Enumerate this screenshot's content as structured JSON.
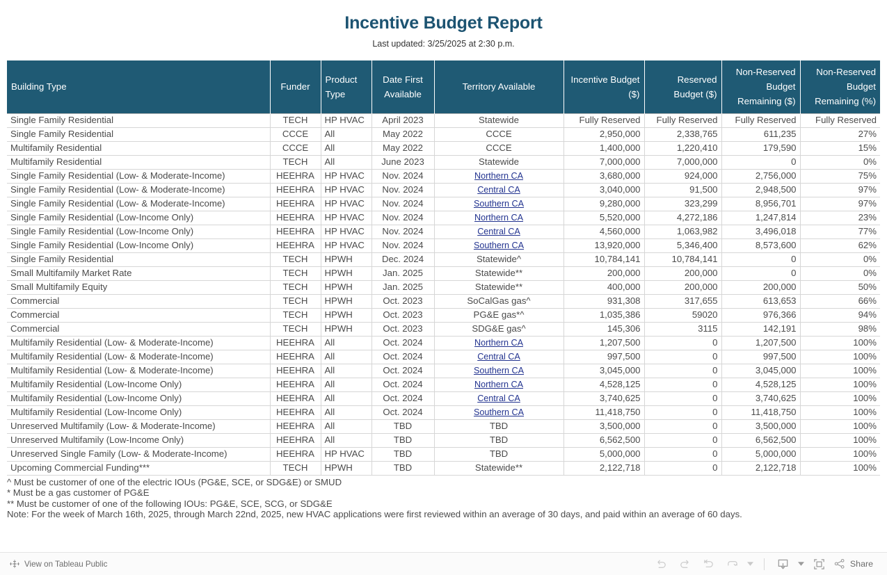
{
  "header": {
    "title": "Incentive Budget Report",
    "subtitle": "Last updated: 3/25/2025 at 2:30 p.m.",
    "title_color": "#1c5371"
  },
  "table": {
    "header_bg": "#1f5a74",
    "link_color": "#22338f",
    "columns": [
      {
        "label": "Building Type",
        "align": "h-left"
      },
      {
        "label": "Funder",
        "align": "h-center"
      },
      {
        "label": "Product Type",
        "align": "h-left"
      },
      {
        "label": "Date First Available",
        "align": "h-center"
      },
      {
        "label": "Territory Available",
        "align": "h-center"
      },
      {
        "label": "Incentive Budget ($)",
        "align": "h-right"
      },
      {
        "label": "Reserved Budget ($)",
        "align": "h-right"
      },
      {
        "label": "Non-Reserved Budget Remaining ($)",
        "align": "h-right"
      },
      {
        "label": "Non-Reserved Budget Remaining (%)",
        "align": "h-right"
      }
    ],
    "rows": [
      {
        "building_type": "Single Family Residential",
        "funder": "TECH",
        "product_type": "HP HVAC",
        "date_first_available": "April 2023",
        "territory": "Statewide",
        "territory_link": false,
        "incentive_budget": "Fully Reserved",
        "reserved_budget": "Fully Reserved",
        "non_reserved_remaining": "Fully Reserved",
        "non_reserved_pct": "Fully Reserved",
        "group_end": false
      },
      {
        "building_type": "Single Family Residential",
        "funder": "CCCE",
        "product_type": "All",
        "date_first_available": "May 2022",
        "territory": "CCCE",
        "territory_link": false,
        "incentive_budget": "2,950,000",
        "reserved_budget": "2,338,765",
        "non_reserved_remaining": "611,235",
        "non_reserved_pct": "27%",
        "group_end": false
      },
      {
        "building_type": "Multifamily Residential",
        "funder": "CCCE",
        "product_type": "All",
        "date_first_available": "May 2022",
        "territory": "CCCE",
        "territory_link": false,
        "incentive_budget": "1,400,000",
        "reserved_budget": "1,220,410",
        "non_reserved_remaining": "179,590",
        "non_reserved_pct": "15%",
        "group_end": false
      },
      {
        "building_type": "Multifamily Residential",
        "funder": "TECH",
        "product_type": "All",
        "date_first_available": "June 2023",
        "territory": "Statewide",
        "territory_link": false,
        "incentive_budget": "7,000,000",
        "reserved_budget": "7,000,000",
        "non_reserved_remaining": "0",
        "non_reserved_pct": "0%",
        "group_end": true
      },
      {
        "building_type": "Single Family Residential (Low- & Moderate-Income)",
        "funder": "HEEHRA",
        "product_type": "HP HVAC",
        "date_first_available": "Nov. 2024",
        "territory": "Northern CA",
        "territory_link": true,
        "incentive_budget": "3,680,000",
        "reserved_budget": "924,000",
        "non_reserved_remaining": "2,756,000",
        "non_reserved_pct": "75%",
        "group_end": false
      },
      {
        "building_type": "Single Family Residential (Low- & Moderate-Income)",
        "funder": "HEEHRA",
        "product_type": "HP HVAC",
        "date_first_available": "Nov. 2024",
        "territory": "Central CA",
        "territory_link": true,
        "incentive_budget": "3,040,000",
        "reserved_budget": "91,500",
        "non_reserved_remaining": "2,948,500",
        "non_reserved_pct": "97%",
        "group_end": false
      },
      {
        "building_type": "Single Family Residential (Low- & Moderate-Income)",
        "funder": "HEEHRA",
        "product_type": "HP HVAC",
        "date_first_available": "Nov. 2024",
        "territory": "Southern CA",
        "territory_link": true,
        "incentive_budget": "9,280,000",
        "reserved_budget": "323,299",
        "non_reserved_remaining": "8,956,701",
        "non_reserved_pct": "97%",
        "group_end": false
      },
      {
        "building_type": "Single Family Residential (Low-Income Only)",
        "funder": "HEEHRA",
        "product_type": "HP HVAC",
        "date_first_available": "Nov. 2024",
        "territory": "Northern CA",
        "territory_link": true,
        "incentive_budget": "5,520,000",
        "reserved_budget": "4,272,186",
        "non_reserved_remaining": "1,247,814",
        "non_reserved_pct": "23%",
        "group_end": false
      },
      {
        "building_type": "Single Family Residential (Low-Income Only)",
        "funder": "HEEHRA",
        "product_type": "HP HVAC",
        "date_first_available": "Nov. 2024",
        "territory": "Central CA",
        "territory_link": true,
        "incentive_budget": "4,560,000",
        "reserved_budget": "1,063,982",
        "non_reserved_remaining": "3,496,018",
        "non_reserved_pct": "77%",
        "group_end": false
      },
      {
        "building_type": "Single Family Residential (Low-Income Only)",
        "funder": "HEEHRA",
        "product_type": "HP HVAC",
        "date_first_available": "Nov. 2024",
        "territory": "Southern CA",
        "territory_link": true,
        "incentive_budget": "13,920,000",
        "reserved_budget": "5,346,400",
        "non_reserved_remaining": "8,573,600",
        "non_reserved_pct": "62%",
        "group_end": true
      },
      {
        "building_type": "Single Family Residential",
        "funder": "TECH",
        "product_type": "HPWH",
        "date_first_available": "Dec. 2024",
        "territory": "Statewide^",
        "territory_link": false,
        "incentive_budget": "10,784,141",
        "reserved_budget": "10,784,141",
        "non_reserved_remaining": "0",
        "non_reserved_pct": "0%",
        "group_end": true
      },
      {
        "building_type": "Small Multifamily Market Rate",
        "funder": "TECH",
        "product_type": "HPWH",
        "date_first_available": "Jan. 2025",
        "territory": "Statewide**",
        "territory_link": false,
        "incentive_budget": "200,000",
        "reserved_budget": "200,000",
        "non_reserved_remaining": "0",
        "non_reserved_pct": "0%",
        "group_end": false
      },
      {
        "building_type": "Small Multifamily Equity",
        "funder": "TECH",
        "product_type": "HPWH",
        "date_first_available": "Jan. 2025",
        "territory": "Statewide**",
        "territory_link": false,
        "incentive_budget": "400,000",
        "reserved_budget": "200,000",
        "non_reserved_remaining": "200,000",
        "non_reserved_pct": "50%",
        "group_end": true
      },
      {
        "building_type": "Commercial",
        "funder": "TECH",
        "product_type": "HPWH",
        "date_first_available": "Oct. 2023",
        "territory": "SoCalGas gas^",
        "territory_link": false,
        "incentive_budget": "931,308",
        "reserved_budget": "317,655",
        "non_reserved_remaining": "613,653",
        "non_reserved_pct": "66%",
        "group_end": false
      },
      {
        "building_type": "Commercial",
        "funder": "TECH",
        "product_type": "HPWH",
        "date_first_available": "Oct. 2023",
        "territory": "PG&E gas*^",
        "territory_link": false,
        "incentive_budget": "1,035,386",
        "reserved_budget": "59020",
        "non_reserved_remaining": "976,366",
        "non_reserved_pct": "94%",
        "group_end": false
      },
      {
        "building_type": "Commercial",
        "funder": "TECH",
        "product_type": "HPWH",
        "date_first_available": "Oct. 2023",
        "territory": "SDG&E gas^",
        "territory_link": false,
        "incentive_budget": "145,306",
        "reserved_budget": "3115",
        "non_reserved_remaining": "142,191",
        "non_reserved_pct": "98%",
        "group_end": true
      },
      {
        "building_type": "Multifamily Residential (Low- & Moderate-Income)",
        "funder": "HEEHRA",
        "product_type": "All",
        "date_first_available": "Oct. 2024",
        "territory": "Northern CA",
        "territory_link": true,
        "incentive_budget": "1,207,500",
        "reserved_budget": "0",
        "non_reserved_remaining": "1,207,500",
        "non_reserved_pct": "100%",
        "group_end": false
      },
      {
        "building_type": "Multifamily Residential (Low- & Moderate-Income)",
        "funder": "HEEHRA",
        "product_type": "All",
        "date_first_available": "Oct. 2024",
        "territory": "Central CA",
        "territory_link": true,
        "incentive_budget": "997,500",
        "reserved_budget": "0",
        "non_reserved_remaining": "997,500",
        "non_reserved_pct": "100%",
        "group_end": false
      },
      {
        "building_type": "Multifamily Residential (Low- & Moderate-Income)",
        "funder": "HEEHRA",
        "product_type": "All",
        "date_first_available": "Oct. 2024",
        "territory": "Southern CA",
        "territory_link": true,
        "incentive_budget": "3,045,000",
        "reserved_budget": "0",
        "non_reserved_remaining": "3,045,000",
        "non_reserved_pct": "100%",
        "group_end": false
      },
      {
        "building_type": "Multifamily Residential (Low-Income Only)",
        "funder": "HEEHRA",
        "product_type": "All",
        "date_first_available": "Oct. 2024",
        "territory": "Northern CA",
        "territory_link": true,
        "incentive_budget": "4,528,125",
        "reserved_budget": "0",
        "non_reserved_remaining": "4,528,125",
        "non_reserved_pct": "100%",
        "group_end": false
      },
      {
        "building_type": "Multifamily Residential (Low-Income Only)",
        "funder": "HEEHRA",
        "product_type": "All",
        "date_first_available": "Oct. 2024",
        "territory": "Central CA",
        "territory_link": true,
        "incentive_budget": "3,740,625",
        "reserved_budget": "0",
        "non_reserved_remaining": "3,740,625",
        "non_reserved_pct": "100%",
        "group_end": false
      },
      {
        "building_type": "Multifamily Residential (Low-Income Only)",
        "funder": "HEEHRA",
        "product_type": "All",
        "date_first_available": "Oct. 2024",
        "territory": "Southern CA",
        "territory_link": true,
        "incentive_budget": "11,418,750",
        "reserved_budget": "0",
        "non_reserved_remaining": "11,418,750",
        "non_reserved_pct": "100%",
        "group_end": true
      },
      {
        "building_type": "Unreserved Multifamily (Low- & Moderate-Income)",
        "funder": "HEEHRA",
        "product_type": "All",
        "date_first_available": "TBD",
        "territory": "TBD",
        "territory_link": false,
        "incentive_budget": "3,500,000",
        "reserved_budget": "0",
        "non_reserved_remaining": "3,500,000",
        "non_reserved_pct": "100%",
        "group_end": false
      },
      {
        "building_type": "Unreserved Multifamily (Low-Income Only)",
        "funder": "HEEHRA",
        "product_type": "All",
        "date_first_available": "TBD",
        "territory": "TBD",
        "territory_link": false,
        "incentive_budget": "6,562,500",
        "reserved_budget": "0",
        "non_reserved_remaining": "6,562,500",
        "non_reserved_pct": "100%",
        "group_end": false
      },
      {
        "building_type": "Unreserved Single Family (Low- & Moderate-Income)",
        "funder": "HEEHRA",
        "product_type": "HP HVAC",
        "date_first_available": "TBD",
        "territory": "TBD",
        "territory_link": false,
        "incentive_budget": "5,000,000",
        "reserved_budget": "0",
        "non_reserved_remaining": "5,000,000",
        "non_reserved_pct": "100%",
        "group_end": true
      },
      {
        "building_type": "Upcoming Commercial Funding***",
        "funder": "TECH",
        "product_type": "HPWH",
        "date_first_available": "TBD",
        "territory": "Statewide**",
        "territory_link": false,
        "incentive_budget": "2,122,718",
        "reserved_budget": "0",
        "non_reserved_remaining": "2,122,718",
        "non_reserved_pct": "100%",
        "group_end": true
      }
    ]
  },
  "footnotes": [
    "^  Must be customer of one of the electric IOUs (PG&E, SCE, or SDG&E) or SMUD",
    "* Must be a gas customer of PG&E",
    "** Must be customer of one of the following IOUs: PG&E, SCE, SCG, or SDG&E",
    "Note: For the week of March 16th, 2025, through March 22nd, 2025, new HVAC applications were first reviewed within an average of 30 days, and paid within an average of 60 days."
  ],
  "toolbar": {
    "view_on_tableau_public": "View on Tableau Public",
    "share_label": "Share"
  }
}
